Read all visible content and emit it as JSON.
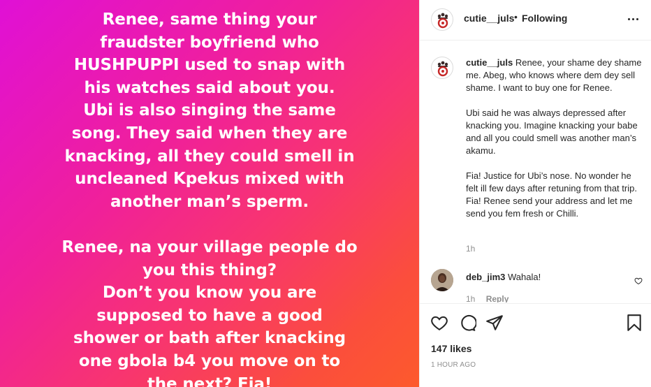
{
  "story": {
    "text": "Renee, same thing your\nfraudster boyfriend who\nHUSHPUPPI used to snap with\nhis watches said about you.\nUbi is also singing the same\nsong. They said when they are\nknacking, all they could smell in\nuncleaned Kpekus mixed with\nanother man’s sperm.\n\nRenee, na your village people do\nyou this thing?\nDon’t you know you are\nsupposed to have a good\nshower or bath after knacking\none gbola b4 you move on to\nthe next? Fia!"
  },
  "header": {
    "username": "cutie__juls",
    "separator": "•",
    "follow_status": "Following"
  },
  "caption": {
    "username": "cutie__juls",
    "paragraph1": "Renee, your shame dey shame me. Abeg, who knows where dem dey sell shame. I want to buy one for Renee.",
    "paragraph2": "Ubi said he was always depressed after knacking you. Imagine knacking your babe and all you could smell was another man’s akamu.",
    "paragraph3": "Fia! Justice for Ubi’s nose. No wonder he felt ill few days after retuning from that trip. Fia! Renee send your address and let me send you fem fresh or Chilli.",
    "time": "1h"
  },
  "comment": {
    "username": "deb_jim3",
    "text": "Wahala!",
    "time": "1h",
    "reply_label": "Reply"
  },
  "footer": {
    "likes": "147 likes",
    "posted": "1 HOUR AGO"
  },
  "colors": {
    "gradient_start": "#e010d6",
    "gradient_end": "#fd5a2c",
    "text_primary": "#262626",
    "text_secondary": "#8e8e8e"
  }
}
